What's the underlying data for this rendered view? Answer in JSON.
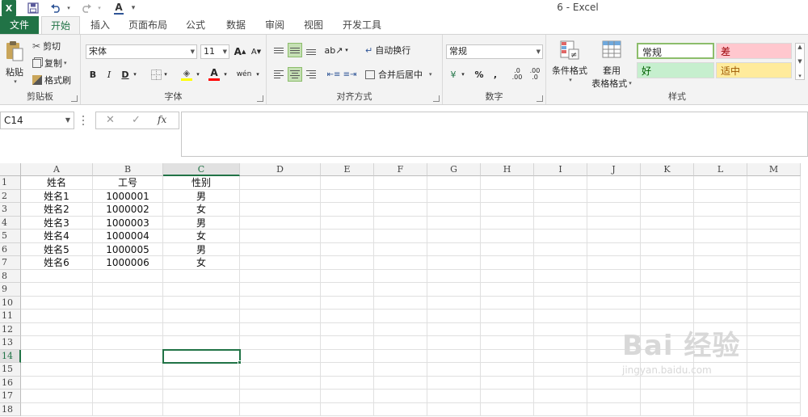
{
  "window": {
    "title": "6 - Excel"
  },
  "qat": {
    "logo": "X",
    "save_icon": "save-icon",
    "undo_icon": "undo-icon",
    "redo_icon": "redo-icon",
    "font_color_icon": "font-color-icon",
    "customize": "▾"
  },
  "tabs": [
    "文件",
    "开始",
    "插入",
    "页面布局",
    "公式",
    "数据",
    "审阅",
    "视图",
    "开发工具"
  ],
  "ribbon": {
    "clipboard": {
      "label": "剪贴板",
      "paste": "粘贴",
      "cut": "剪切",
      "copy": "复制",
      "format_painter": "格式刷"
    },
    "font": {
      "label": "字体",
      "name": "宋体",
      "size": "11",
      "bold": "B",
      "italic": "I",
      "underline": "D",
      "wen": "wén",
      "font_color_letter": "A",
      "grow": "A",
      "shrink": "A"
    },
    "alignment": {
      "label": "对齐方式",
      "wrap_text": "自动换行",
      "merge_center": "合并后居中"
    },
    "number": {
      "label": "数字",
      "format": "常规",
      "percent": "%",
      "comma": ",",
      "inc_dec": ".00",
      "dec_dec": ".0"
    },
    "styles": {
      "label": "样式",
      "conditional_format": "条件格式",
      "table_format_line1": "套用",
      "table_format_line2": "表格格式",
      "normal": "常规",
      "bad": "差",
      "good": "好",
      "neutral": "适中",
      "colors": {
        "bad_bg": "#ffc7ce",
        "bad_fg": "#9c0006",
        "good_bg": "#c6efce",
        "good_fg": "#006100",
        "neutral_bg": "#ffeb9c",
        "neutral_fg": "#9c5700"
      }
    }
  },
  "formula_bar": {
    "name_box": "C14",
    "cancel": "✕",
    "enter": "✓",
    "fx": "fx",
    "value": ""
  },
  "sheet": {
    "columns": [
      "A",
      "B",
      "C",
      "D",
      "E",
      "F",
      "G",
      "H",
      "I",
      "J",
      "K",
      "L",
      "M"
    ],
    "rows": [
      "1",
      "2",
      "3",
      "4",
      "5",
      "6",
      "7",
      "8",
      "9",
      "10",
      "11",
      "12",
      "13",
      "14",
      "15",
      "16",
      "17",
      "18"
    ],
    "active_cell": "C14",
    "data": [
      [
        "姓名",
        "工号",
        "性别"
      ],
      [
        "姓名1",
        "1000001",
        "男"
      ],
      [
        "姓名2",
        "1000002",
        "女"
      ],
      [
        "姓名3",
        "1000003",
        "男"
      ],
      [
        "姓名4",
        "1000004",
        "女"
      ],
      [
        "姓名5",
        "1000005",
        "男"
      ],
      [
        "姓名6",
        "1000006",
        "女"
      ]
    ]
  },
  "watermark": {
    "brand": "Bai 经验",
    "url": "jingyan.baidu.com"
  },
  "accent": "#217346"
}
